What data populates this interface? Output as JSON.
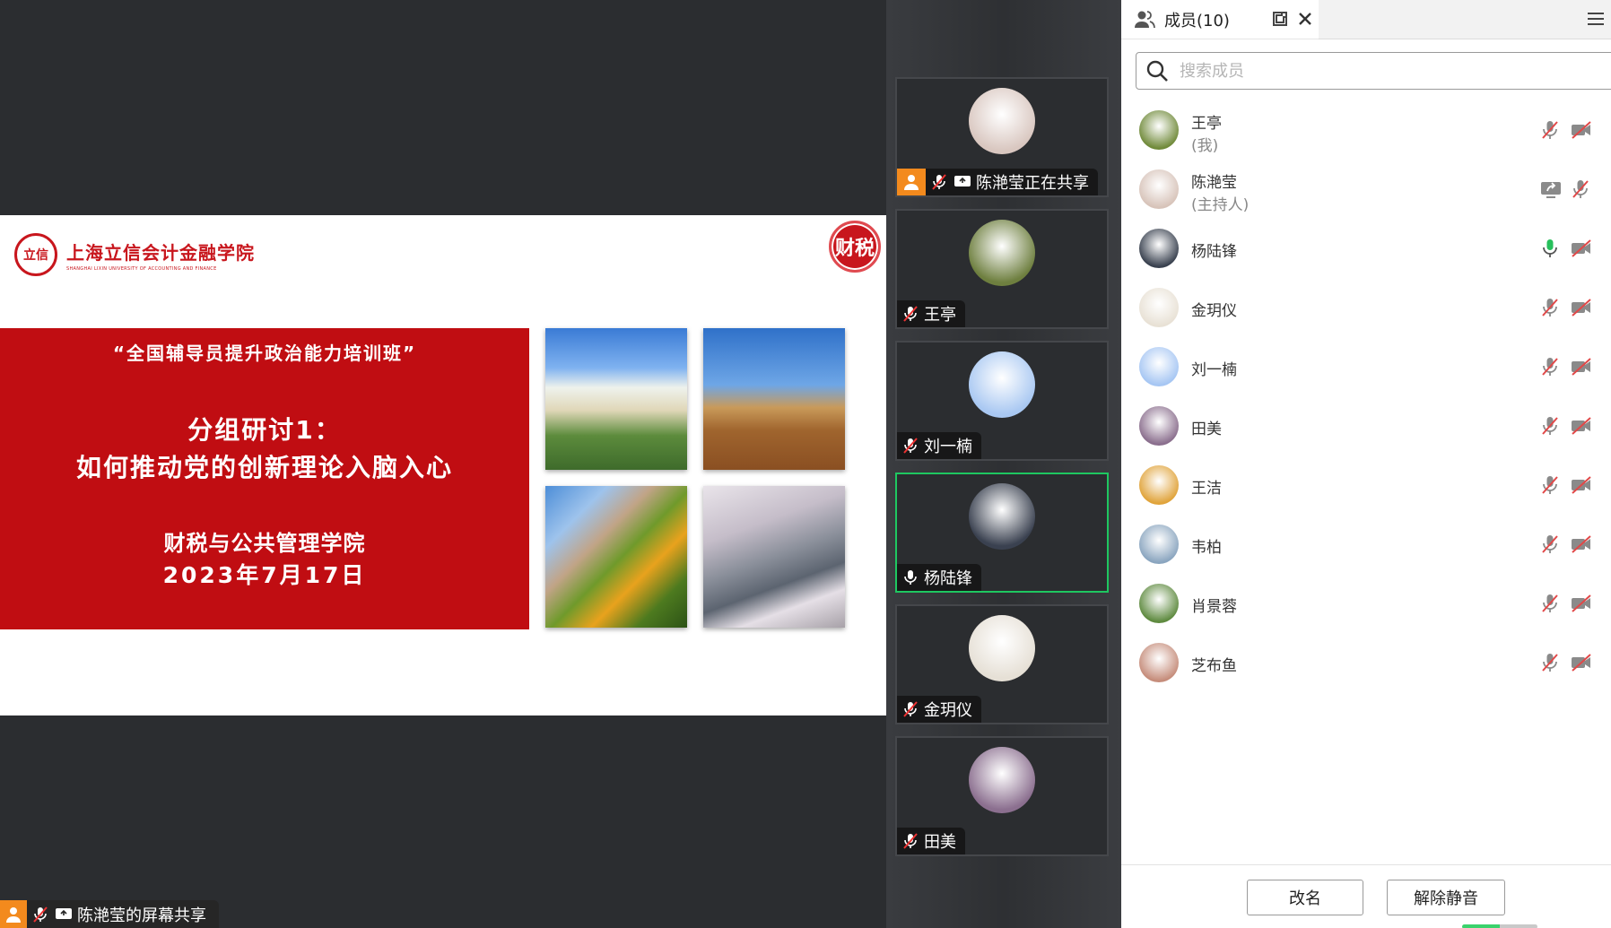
{
  "slide": {
    "university_name": "上海立信会计金融学院",
    "university_name_en": "SHANGHAI LIXIN UNIVERSITY OF ACCOUNTING AND FINANCE",
    "seal_left": "立信",
    "seal_right": "财税",
    "line1": "“全国辅导员提升政治能力培训班”",
    "line2": "分组研讨1：",
    "line3": "如何推动党的创新理论入脑入心",
    "line4": "财税与公共管理学院",
    "line5": "2023年7月17日"
  },
  "share_label": "陈滟莹的屏幕共享",
  "video_tiles": [
    {
      "name": "陈滟莹正在共享",
      "active": false,
      "avatar_color": "#d9c7c0"
    },
    {
      "name": "王亭",
      "active": false,
      "avatar_color": "#6e7f3f"
    },
    {
      "name": "刘一楠",
      "active": false,
      "avatar_color": "#a9c8f2"
    },
    {
      "name": "杨陆锋",
      "active": true,
      "avatar_color": "#3a4150"
    },
    {
      "name": "金玥仪",
      "active": false,
      "avatar_color": "#e6e0d6"
    },
    {
      "name": "田美",
      "active": false,
      "avatar_color": "#8b6f8f"
    }
  ],
  "panel": {
    "title": "成员(10)",
    "search_placeholder": "搜索成员",
    "members": [
      {
        "name": "王亭",
        "role": "(我)",
        "avatar_color": "#708a3a",
        "icon1": "mic-muted",
        "icon2": "camera-off"
      },
      {
        "name": "陈滟莹",
        "role": "(主持人)",
        "avatar_color": "#d7c3b9",
        "icon1": "screen-share",
        "icon2": "mic-muted"
      },
      {
        "name": "杨陆锋",
        "role": "",
        "avatar_color": "#38404e",
        "icon1": "mic-on",
        "icon2": "camera-off"
      },
      {
        "name": "金玥仪",
        "role": "",
        "avatar_color": "#e8e1d5",
        "icon1": "mic-muted",
        "icon2": "camera-off"
      },
      {
        "name": "刘一楠",
        "role": "",
        "avatar_color": "#a6c6f3",
        "icon1": "mic-muted",
        "icon2": "camera-off"
      },
      {
        "name": "田美",
        "role": "",
        "avatar_color": "#8a6e8d",
        "icon1": "mic-muted",
        "icon2": "camera-off"
      },
      {
        "name": "王洁",
        "role": "",
        "avatar_color": "#e0a33a",
        "icon1": "mic-muted",
        "icon2": "camera-off"
      },
      {
        "name": "韦柏",
        "role": "",
        "avatar_color": "#8aa5bf",
        "icon1": "mic-muted",
        "icon2": "camera-off"
      },
      {
        "name": "肖景蓉",
        "role": "",
        "avatar_color": "#5e8a3f",
        "icon1": "mic-muted",
        "icon2": "camera-off"
      },
      {
        "name": "芝布鱼",
        "role": "",
        "avatar_color": "#c58c7a",
        "icon1": "mic-muted",
        "icon2": "camera-off"
      }
    ],
    "rename_label": "改名",
    "unmute_label": "解除静音"
  }
}
